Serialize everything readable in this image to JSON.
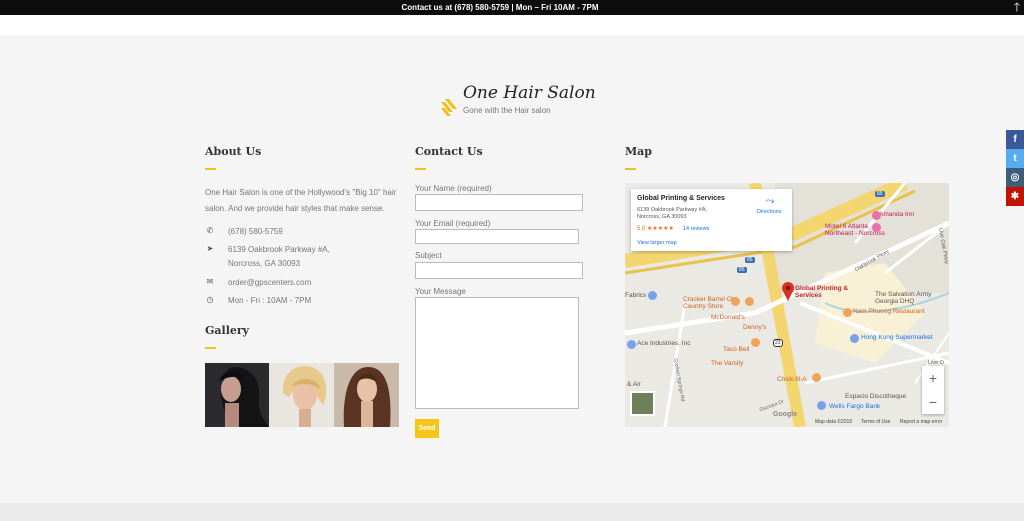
{
  "topbar": {
    "contact_text": "Contact us at (678) 580-5759 | Mon – Fri 10AM - 7PM"
  },
  "logo": {
    "title": "One Hair Salon",
    "tagline": "Gone with the Hair salon",
    "accent": "#f0c020"
  },
  "about": {
    "heading": "About Us",
    "text": "One Hair Salon is one of the Hollywood's \"Big 10\" hair salon. And we provide hair styles that make sense.",
    "items": [
      {
        "icon": "phone-icon",
        "text": "(678) 580-5759"
      },
      {
        "icon": "location-arrow-icon",
        "text": "6139 Oakbrook Parkway #A, Norcross, GA 30093"
      },
      {
        "icon": "envelope-icon",
        "text": "order@gpscenters.com"
      },
      {
        "icon": "clock-icon",
        "text": "Mon - Fri : 10AM - 7PM"
      }
    ]
  },
  "gallery": {
    "heading": "Gallery"
  },
  "contact": {
    "heading": "Contact Us",
    "name_label": "Your Name (required)",
    "email_label": "Your Email (required)",
    "subject_label": "Subject",
    "message_label": "Your Message",
    "send_label": "Send"
  },
  "map": {
    "heading": "Map",
    "card": {
      "title": "Global Printing & Services",
      "address": "6139 Oakbrook Parkway #A, Norcross, GA 30093",
      "rating": "5.0 ★★★★★",
      "reviews": "14 reviews",
      "larger_map": "View larger map",
      "directions": "Directions"
    },
    "pin_label": "Global Printing & Services",
    "places": [
      "Amanda Inn",
      "Motel 6 Atlanta Northeast - Norcross",
      "Cracker Barrel Old Country Store",
      "McDonald's",
      "Denny's",
      "Taco Bell",
      "The Varsity",
      "Chick-fil-A",
      "Ace Industries, Inc",
      "Hong Kong Supermarket",
      "The Salvation Army Georgia DHQ",
      "Nam Phuong Restaurant",
      "Espacio Discotheque",
      "Wells Fargo Bank",
      "Fabrics"
    ],
    "roads": [
      "Oakbrook Pkwy",
      "Live Oak Pkwy",
      "Live O",
      "Goshen Springs Rd",
      "Gazzara Dr"
    ],
    "route_shields": [
      "85",
      "85",
      "85",
      "23"
    ],
    "footer": {
      "data": "Map data ©2019",
      "terms": "Terms of Use",
      "report": "Report a map error"
    },
    "zoom_in": "+",
    "zoom_out": "−",
    "google": "Google",
    "air": "& Air"
  },
  "social": [
    {
      "icon": "facebook-icon",
      "glyph": "f",
      "color": "#3b5998"
    },
    {
      "icon": "twitter-icon",
      "glyph": "t",
      "color": "#55acee"
    },
    {
      "icon": "instagram-icon",
      "glyph": "◎",
      "color": "#3f5c7a"
    },
    {
      "icon": "yelp-icon",
      "glyph": "✱",
      "color": "#c41200"
    }
  ]
}
